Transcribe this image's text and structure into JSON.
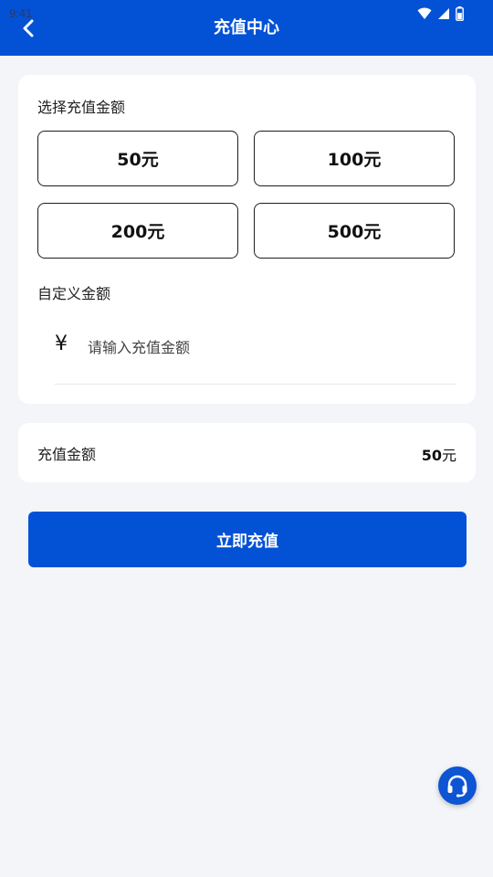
{
  "status_bar": {
    "time": "9:41",
    "icons": [
      "wifi-icon",
      "signal-icon",
      "battery-icon"
    ]
  },
  "header": {
    "title": "充值中心",
    "back_icon": "chevron-left-icon"
  },
  "amount_section": {
    "label": "选择充值金额",
    "options": [
      "50元",
      "100元",
      "200元",
      "500元"
    ],
    "selected": "50元"
  },
  "custom_section": {
    "label": "自定义金额",
    "currency_symbol": "¥",
    "placeholder": "请输入充值金额",
    "value": ""
  },
  "summary": {
    "label": "充值金额",
    "amount": "50",
    "unit": "元"
  },
  "submit_label": "立即充值",
  "support_icon": "headset-icon",
  "colors": {
    "primary": "#0352d6",
    "background": "#f4f5f9",
    "card": "#ffffff",
    "border": "#1e1e1e"
  }
}
